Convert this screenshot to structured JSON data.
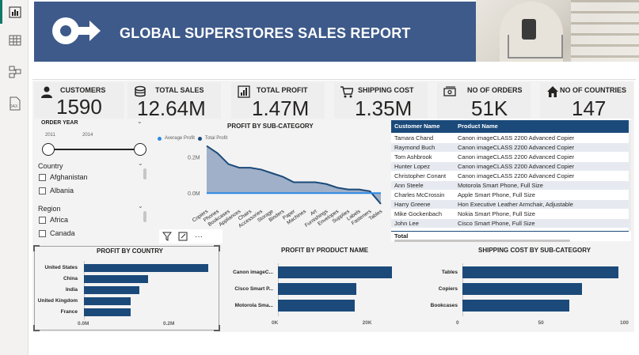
{
  "rail": {
    "icons": [
      "report-view-icon",
      "table-view-icon",
      "model-view-icon",
      "dax-query-icon"
    ],
    "dax_text": "DAX"
  },
  "header": {
    "title": "GLOBAL SUPERSTORES SALES REPORT",
    "accent": "#3d5a8a"
  },
  "kpis": {
    "customers": {
      "label": "CUSTOMERS",
      "value": "1590",
      "icon": "person-icon"
    },
    "total_sales": {
      "label": "TOTAL SALES",
      "value": "12.64M",
      "icon": "coins-icon"
    },
    "total_profit": {
      "label": "TOTAL PROFIT",
      "value": "1.47M",
      "icon": "bar-chart-icon"
    },
    "shipping_cost": {
      "label": "SHIPPING COST",
      "value": "1.35M",
      "icon": "cart-icon"
    },
    "orders": {
      "label": "NO OF ORDERS",
      "value": "51K",
      "icon": "money-icon"
    },
    "countries": {
      "label": "NO OF COUNTRIES",
      "value": "147",
      "icon": "home-icon"
    }
  },
  "slicers": {
    "order_year": {
      "title": "ORDER YEAR",
      "min": "2011",
      "max": "2014"
    },
    "country": {
      "title": "Country",
      "items": [
        "Afghanistan",
        "Albania"
      ]
    },
    "region": {
      "title": "Region",
      "items": [
        "Africa",
        "Canada"
      ]
    }
  },
  "profit_subcat": {
    "title": "PROFIT BY SUB-CATEGORY",
    "legend": [
      "Average Profit",
      "Total Profit"
    ],
    "ticks": [
      "0.2M",
      "0.0M"
    ],
    "toolbar": [
      "filter-icon",
      "focus-mode-icon",
      "more-options-icon"
    ],
    "more_glyph": "···"
  },
  "table": {
    "headers": [
      "Customer Name",
      "Product Name"
    ],
    "rows": [
      [
        "Tamara Chand",
        "Canon imageCLASS 2200 Advanced Copier"
      ],
      [
        "Raymond Buch",
        "Canon imageCLASS 2200 Advanced Copier"
      ],
      [
        "Tom Ashbrook",
        "Canon imageCLASS 2200 Advanced Copier"
      ],
      [
        "Hunter Lopez",
        "Canon imageCLASS 2200 Advanced Copier"
      ],
      [
        "Christopher Conant",
        "Canon imageCLASS 2200 Advanced Copier"
      ],
      [
        "Ann Steele",
        "Motorola Smart Phone, Full Size"
      ],
      [
        "Charles McCrossin",
        "Apple Smart Phone, Full Size"
      ],
      [
        "Harry Greene",
        "Hon Executive Leather Armchair, Adjustable"
      ],
      [
        "Mike Gockenbach",
        "Nokia Smart Phone, Full Size"
      ],
      [
        "John Lee",
        "Cisco Smart Phone, Full Size"
      ]
    ],
    "total_label": "Total"
  },
  "chart_data": [
    {
      "type": "area",
      "title": "PROFIT BY SUB-CATEGORY",
      "categories": [
        "Copiers",
        "Phones",
        "Bookcases",
        "Appliances",
        "Chairs",
        "Accessories",
        "Storage",
        "Binders",
        "Paper",
        "Machines",
        "Art",
        "Furnishings",
        "Envelopes",
        "Supplies",
        "Labels",
        "Fasteners",
        "Tables"
      ],
      "series": [
        {
          "name": "Average Profit",
          "values": [
            0.0,
            0.0,
            0.0,
            0.0,
            0.0,
            0.0,
            0.0,
            0.0,
            0.0,
            0.0,
            0.0,
            0.0,
            0.0,
            0.0,
            0.0,
            0.0,
            0.0
          ],
          "color": "#2b8ae6"
        },
        {
          "name": "Total Profit",
          "values": [
            0.26,
            0.22,
            0.16,
            0.14,
            0.14,
            0.13,
            0.11,
            0.09,
            0.06,
            0.06,
            0.06,
            0.05,
            0.03,
            0.02,
            0.02,
            0.01,
            -0.06
          ],
          "color": "#1b4a7a"
        }
      ],
      "ylim": [
        -0.06,
        0.28
      ],
      "y_unit": "M"
    },
    {
      "type": "bar",
      "title": "PROFIT BY COUNTRY",
      "categories": [
        "United States",
        "China",
        "India",
        "United Kingdom",
        "France"
      ],
      "values": [
        0.29,
        0.15,
        0.13,
        0.11,
        0.11
      ],
      "xticks": [
        "0.0M",
        "0.2M"
      ],
      "xlim": [
        0,
        0.3
      ],
      "color": "#1b4a7a"
    },
    {
      "type": "bar",
      "title": "PROFIT BY PRODUCT NAME",
      "categories": [
        "Canon imageC...",
        "Cisco Smart P...",
        "Motorola Sma..."
      ],
      "values": [
        25200,
        17200,
        17000
      ],
      "xticks": [
        "0K",
        "20K"
      ],
      "xlim": [
        0,
        30000
      ],
      "color": "#1b4a7a"
    },
    {
      "type": "bar",
      "title": "SHIPPING COST BY SUB-CATEGORY",
      "categories": [
        "Tables",
        "Copiers",
        "Bookcases"
      ],
      "values": [
        95,
        73,
        65
      ],
      "xticks": [
        "0",
        "50",
        "100"
      ],
      "xlim": [
        0,
        100
      ],
      "color": "#1b4a7a"
    }
  ]
}
